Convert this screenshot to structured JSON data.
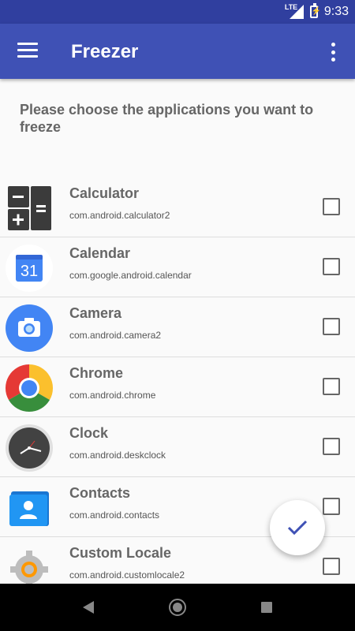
{
  "statusbar": {
    "network": "LTE",
    "time": "9:33"
  },
  "appbar": {
    "title": "Freezer",
    "menu_icon": "hamburger-menu-icon",
    "overflow_icon": "more-vert-icon"
  },
  "instruction": "Please choose the applications you want to freeze",
  "apps": [
    {
      "name": "Calculator",
      "package": "com.android.calculator2",
      "icon": "calculator-icon",
      "checked": false
    },
    {
      "name": "Calendar",
      "package": "com.google.android.calendar",
      "icon": "calendar-icon",
      "icon_text": "31",
      "checked": false
    },
    {
      "name": "Camera",
      "package": "com.android.camera2",
      "icon": "camera-icon",
      "checked": false
    },
    {
      "name": "Chrome",
      "package": "com.android.chrome",
      "icon": "chrome-icon",
      "checked": false
    },
    {
      "name": "Clock",
      "package": "com.android.deskclock",
      "icon": "clock-icon",
      "checked": false
    },
    {
      "name": "Contacts",
      "package": "com.android.contacts",
      "icon": "contacts-icon",
      "checked": false
    },
    {
      "name": "Custom Locale",
      "package": "com.android.customlocale2",
      "icon": "settings-gear-icon",
      "checked": false
    }
  ],
  "fab": {
    "icon": "check-icon",
    "color": "#3f51b5"
  },
  "colors": {
    "primary": "#3f51b5",
    "primary_dark": "#303f9f"
  }
}
